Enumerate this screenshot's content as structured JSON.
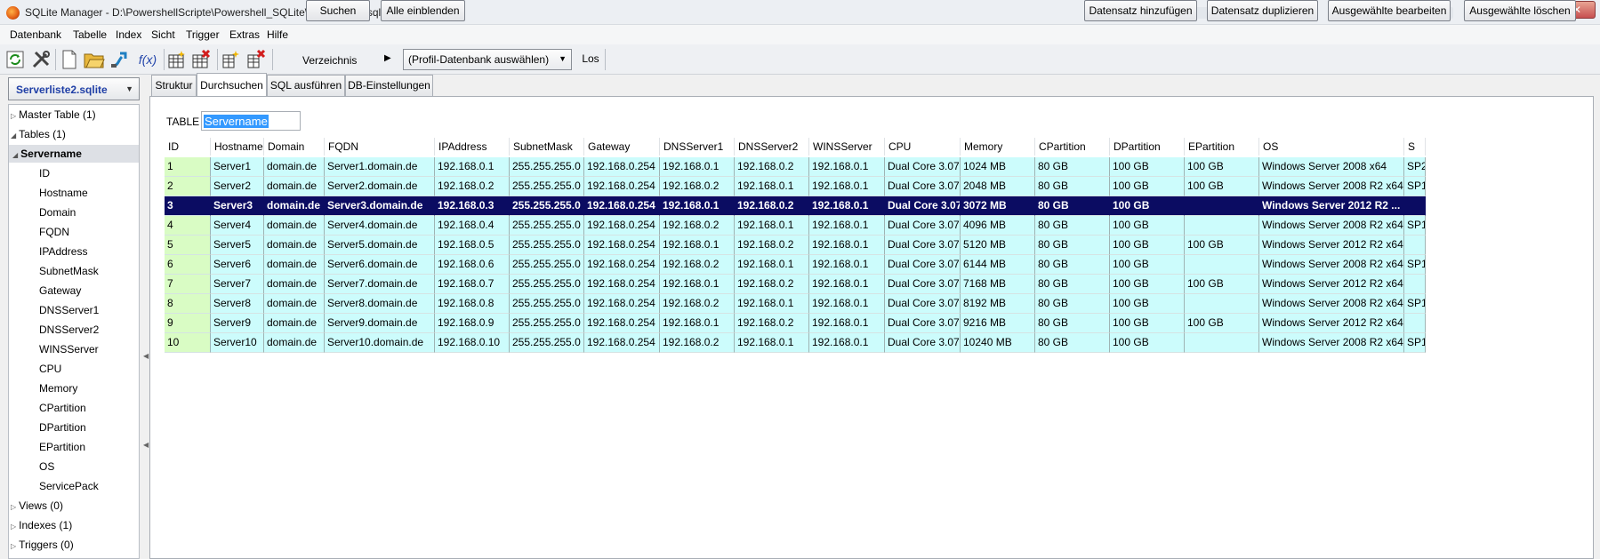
{
  "window": {
    "title": "SQLite Manager - D:\\PowershellScripte\\Powershell_SQLite\\Serverliste2.sqlite",
    "minimize": "–",
    "maximize": "□",
    "close": "✕"
  },
  "menu": [
    "Datenbank",
    "Tabelle",
    "Index",
    "Sicht",
    "Trigger",
    "Extras",
    "Hilfe"
  ],
  "toolbar": {
    "icons": [
      "refresh-icon",
      "tools-icon",
      "new-db-icon",
      "open-db-icon",
      "connect-icon",
      "function-icon",
      "create-table-icon",
      "drop-table-icon",
      "create-index-icon",
      "drop-index-icon"
    ],
    "function_label": "f(x)",
    "directory_label": "Verzeichnis",
    "profile_select": "(Profil-Datenbank auswählen)",
    "go_label": "Los"
  },
  "db_select": "Serverliste2.sqlite",
  "tree": [
    {
      "label": "Master Table (1)",
      "level": 0,
      "toggle": "▷"
    },
    {
      "label": "Tables (1)",
      "level": 0,
      "toggle": "◢"
    },
    {
      "label": "Servername",
      "level": 1,
      "toggle": "◢",
      "selected": true
    },
    {
      "label": "ID",
      "level": 2
    },
    {
      "label": "Hostname",
      "level": 2
    },
    {
      "label": "Domain",
      "level": 2
    },
    {
      "label": "FQDN",
      "level": 2
    },
    {
      "label": "IPAddress",
      "level": 2
    },
    {
      "label": "SubnetMask",
      "level": 2
    },
    {
      "label": "Gateway",
      "level": 2
    },
    {
      "label": "DNSServer1",
      "level": 2
    },
    {
      "label": "DNSServer2",
      "level": 2
    },
    {
      "label": "WINSServer",
      "level": 2
    },
    {
      "label": "CPU",
      "level": 2
    },
    {
      "label": "Memory",
      "level": 2
    },
    {
      "label": "CPartition",
      "level": 2
    },
    {
      "label": "DPartition",
      "level": 2
    },
    {
      "label": "EPartition",
      "level": 2
    },
    {
      "label": "OS",
      "level": 2
    },
    {
      "label": "ServicePack",
      "level": 2
    },
    {
      "label": "Views (0)",
      "level": 0,
      "toggle": "▷"
    },
    {
      "label": "Indexes (1)",
      "level": 0,
      "toggle": "▷"
    },
    {
      "label": "Triggers (0)",
      "level": 0,
      "toggle": "▷"
    }
  ],
  "tabs": [
    "Struktur",
    "Durchsuchen",
    "SQL ausführen",
    "DB-Einstellungen"
  ],
  "active_tab": "Durchsuchen",
  "browse": {
    "table_label": "TABLE",
    "table_value": "Servername",
    "search_button": "Suchen",
    "show_all_button": "Alle einblenden",
    "add_button": "Datensatz hinzufügen",
    "duplicate_button": "Datensatz duplizieren",
    "edit_button": "Ausgewählte bearbeiten",
    "delete_button": "Ausgewählte löschen"
  },
  "grid": {
    "columns": [
      "ID",
      "Hostname",
      "Domain",
      "FQDN",
      "IPAddress",
      "SubnetMask",
      "Gateway",
      "DNSServer1",
      "DNSServer2",
      "WINSServer",
      "CPU",
      "Memory",
      "CPartition",
      "DPartition",
      "EPartition",
      "OS",
      "S"
    ],
    "selected_row": 2,
    "row_color": "#ccfcfc",
    "id_color": "#d9fcc4",
    "selected_color": "#0b0c62",
    "rows": [
      [
        "1",
        "Server1",
        "domain.de",
        "Server1.domain.de",
        "192.168.0.1",
        "255.255.255.0",
        "192.168.0.254",
        "192.168.0.1",
        "192.168.0.2",
        "192.168.0.1",
        "Dual Core 3.07 ...",
        "1024 MB",
        "80 GB",
        "100 GB",
        "100 GB",
        "Windows Server 2008 x64",
        "SP2"
      ],
      [
        "2",
        "Server2",
        "domain.de",
        "Server2.domain.de",
        "192.168.0.2",
        "255.255.255.0",
        "192.168.0.254",
        "192.168.0.2",
        "192.168.0.1",
        "192.168.0.1",
        "Dual Core 3.07 ...",
        "2048 MB",
        "80 GB",
        "100 GB",
        "100 GB",
        "Windows Server 2008 R2 x64",
        "SP1"
      ],
      [
        "3",
        "Server3",
        "domain.de",
        "Server3.domain.de",
        "192.168.0.3",
        "255.255.255.0",
        "192.168.0.254",
        "192.168.0.1",
        "192.168.0.2",
        "192.168.0.1",
        "Dual Core 3.07...",
        "3072 MB",
        "80 GB",
        "100 GB",
        "",
        "Windows Server 2012 R2 ...",
        ""
      ],
      [
        "4",
        "Server4",
        "domain.de",
        "Server4.domain.de",
        "192.168.0.4",
        "255.255.255.0",
        "192.168.0.254",
        "192.168.0.2",
        "192.168.0.1",
        "192.168.0.1",
        "Dual Core 3.07 ...",
        "4096 MB",
        "80 GB",
        "100 GB",
        "",
        "Windows Server 2008 R2 x64",
        "SP1"
      ],
      [
        "5",
        "Server5",
        "domain.de",
        "Server5.domain.de",
        "192.168.0.5",
        "255.255.255.0",
        "192.168.0.254",
        "192.168.0.1",
        "192.168.0.2",
        "192.168.0.1",
        "Dual Core 3.07 ...",
        "5120 MB",
        "80 GB",
        "100 GB",
        "100 GB",
        "Windows Server 2012 R2 x64",
        ""
      ],
      [
        "6",
        "Server6",
        "domain.de",
        "Server6.domain.de",
        "192.168.0.6",
        "255.255.255.0",
        "192.168.0.254",
        "192.168.0.2",
        "192.168.0.1",
        "192.168.0.1",
        "Dual Core 3.07 ...",
        "6144 MB",
        "80 GB",
        "100 GB",
        "",
        "Windows Server 2008 R2 x64",
        "SP1"
      ],
      [
        "7",
        "Server7",
        "domain.de",
        "Server7.domain.de",
        "192.168.0.7",
        "255.255.255.0",
        "192.168.0.254",
        "192.168.0.1",
        "192.168.0.2",
        "192.168.0.1",
        "Dual Core 3.07 ...",
        "7168 MB",
        "80 GB",
        "100 GB",
        "100 GB",
        "Windows Server 2012 R2 x64",
        ""
      ],
      [
        "8",
        "Server8",
        "domain.de",
        "Server8.domain.de",
        "192.168.0.8",
        "255.255.255.0",
        "192.168.0.254",
        "192.168.0.2",
        "192.168.0.1",
        "192.168.0.1",
        "Dual Core 3.07 ...",
        "8192 MB",
        "80 GB",
        "100 GB",
        "",
        "Windows Server 2008 R2 x64",
        "SP1"
      ],
      [
        "9",
        "Server9",
        "domain.de",
        "Server9.domain.de",
        "192.168.0.9",
        "255.255.255.0",
        "192.168.0.254",
        "192.168.0.1",
        "192.168.0.2",
        "192.168.0.1",
        "Dual Core 3.07 ...",
        "9216 MB",
        "80 GB",
        "100 GB",
        "100 GB",
        "Windows Server 2012 R2 x64",
        ""
      ],
      [
        "10",
        "Server10",
        "domain.de",
        "Server10.domain.de",
        "192.168.0.10",
        "255.255.255.0",
        "192.168.0.254",
        "192.168.0.2",
        "192.168.0.1",
        "192.168.0.1",
        "Dual Core 3.07 ...",
        "10240 MB",
        "80 GB",
        "100 GB",
        "",
        "Windows Server 2008 R2 x64",
        "SP1"
      ]
    ]
  }
}
